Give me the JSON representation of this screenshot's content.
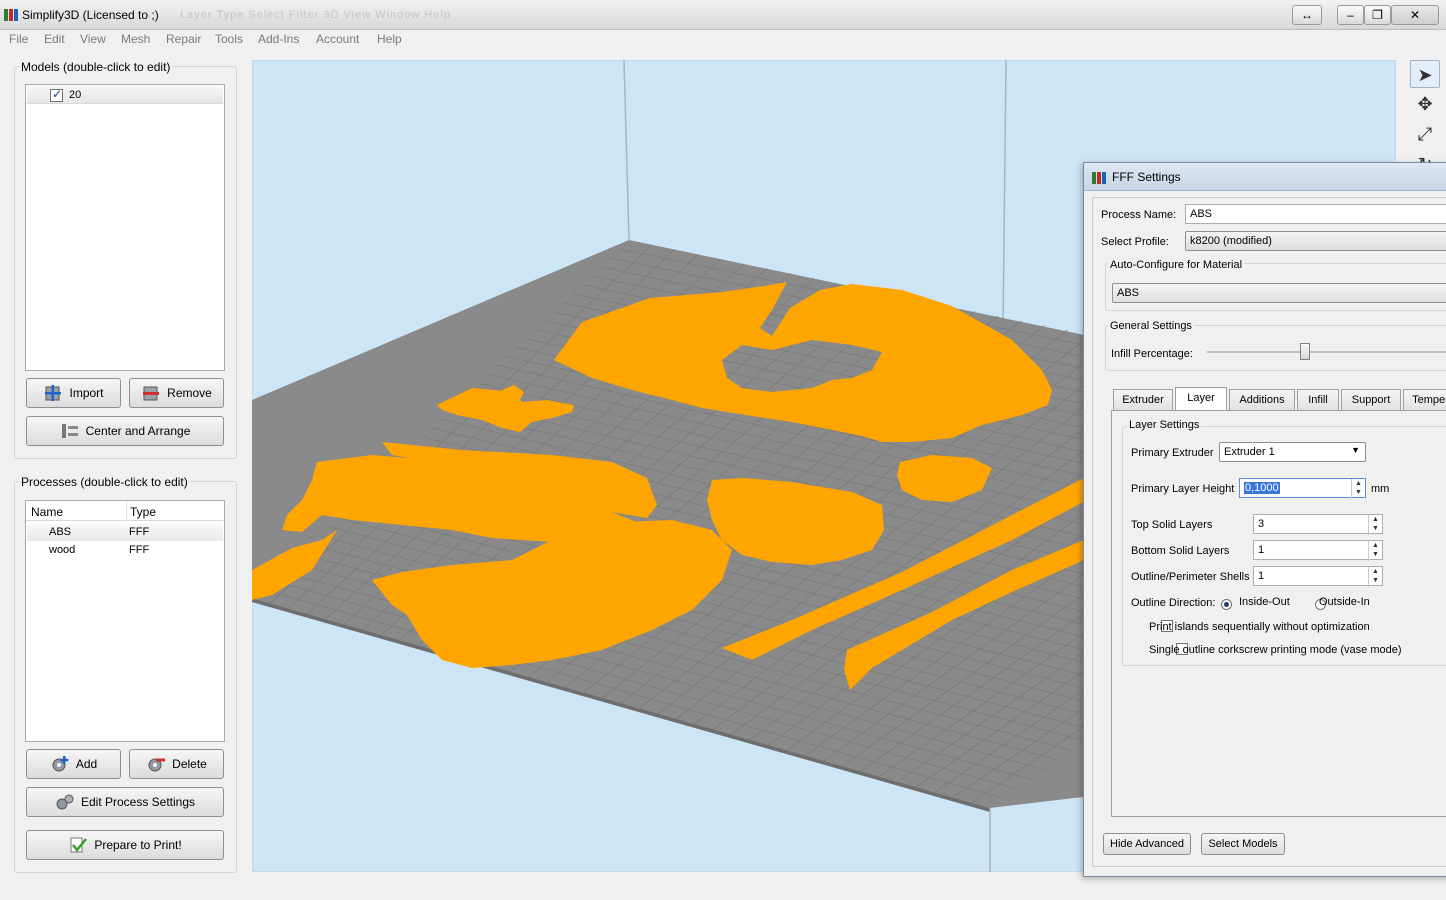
{
  "window": {
    "title": "Simplify3D (Licensed to ;)",
    "ghost_menu": "Layer   Type   Select   Filter   3D   View   Window   Help",
    "btn_resize": "↔",
    "btn_min": "–",
    "btn_max": "❐",
    "btn_close": "✕"
  },
  "menu": [
    "File",
    "Edit",
    "View",
    "Mesh",
    "Repair",
    "Tools",
    "Add-Ins",
    "Account",
    "Help"
  ],
  "models": {
    "title": "Models (double-click to edit)",
    "items": [
      {
        "name": "20",
        "checked": true
      }
    ],
    "import_label": "Import",
    "remove_label": "Remove",
    "center_label": "Center and Arrange"
  },
  "processes": {
    "title": "Processes (double-click to edit)",
    "col_name": "Name",
    "col_type": "Type",
    "rows": [
      {
        "name": "ABS",
        "type": "FFF"
      },
      {
        "name": "wood",
        "type": "FFF"
      }
    ],
    "add_label": "Add",
    "delete_label": "Delete",
    "edit_label": "Edit Process Settings",
    "prepare_label": "Prepare to Print!"
  },
  "colors": {
    "viewport_bg": "#cde6f7",
    "bed": "#8a8a8a",
    "grid": "#7b7b7b",
    "model": "#ffa500"
  },
  "tools": [
    "select-arrow-icon",
    "move-icon",
    "scale-icon",
    "rotate-icon"
  ],
  "fff": {
    "title": "FFF Settings",
    "process_name_label": "Process Name:",
    "process_name": "ABS",
    "profile_label": "Select Profile:",
    "profile": "k8200 (modified)",
    "auto_config_title": "Auto-Configure for Material",
    "material": "ABS",
    "general_title": "General Settings",
    "infill_label": "Infill Percentage:",
    "infill_value": 0.4,
    "tabs": [
      "Extruder",
      "Layer",
      "Additions",
      "Infill",
      "Support",
      "Temper"
    ],
    "active_tab": "Layer",
    "layer_settings_title": "Layer Settings",
    "primary_extruder_label": "Primary Extruder",
    "primary_extruder": "Extruder 1",
    "layer_height_label": "Primary Layer Height",
    "layer_height": "0,1000",
    "layer_height_unit": "mm",
    "top_solid_label": "Top Solid Layers",
    "top_solid": "3",
    "bottom_solid_label": "Bottom Solid Layers",
    "bottom_solid": "1",
    "shells_label": "Outline/Perimeter Shells",
    "shells": "1",
    "direction_label": "Outline Direction:",
    "dir_inside": "Inside-Out",
    "dir_outside": "Outside-In",
    "islands_label": "Print islands sequentially without optimization",
    "vase_label": "Single outline corkscrew printing mode (vase mode)",
    "hide_adv_label": "Hide Advanced",
    "select_models_label": "Select Models"
  }
}
